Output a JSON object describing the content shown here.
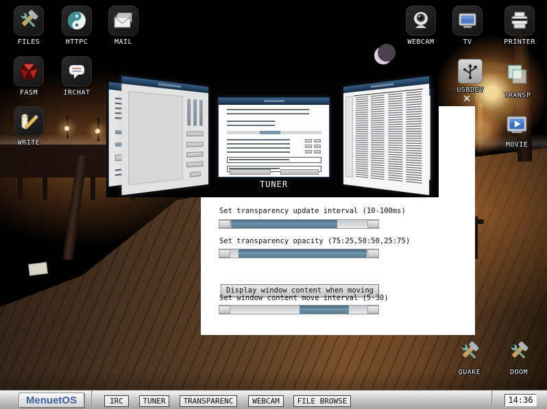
{
  "desktop": {
    "icons": [
      {
        "id": "files",
        "label": "FILES"
      },
      {
        "id": "httpc",
        "label": "HTTPC"
      },
      {
        "id": "mail",
        "label": "MAIL"
      },
      {
        "id": "webcam",
        "label": "WEBCAM"
      },
      {
        "id": "tv",
        "label": "TV"
      },
      {
        "id": "printer",
        "label": "PRINTER"
      },
      {
        "id": "fasm",
        "label": "FASM"
      },
      {
        "id": "irchat",
        "label": "IRCHAT"
      },
      {
        "id": "usbdev",
        "label": "USBDEV"
      },
      {
        "id": "transp",
        "label": "TRANSP"
      },
      {
        "id": "write",
        "label": "WRITE"
      },
      {
        "id": "movie",
        "label": "MOVIE"
      },
      {
        "id": "quake",
        "label": "QUAKE"
      },
      {
        "id": "doom",
        "label": "DOOM"
      }
    ]
  },
  "switcher": {
    "selected_label": "TUNER"
  },
  "transparency_window": {
    "close_icon": "✕",
    "update_interval_label": "Set transparency update interval (10-100ms)",
    "opacity_label": "Set transparency opacity (75:25,50:50,25:75)",
    "display_content_button": "Display window content when moving",
    "move_interval_label": "Set window content move interval (5-30)",
    "sliders": [
      {
        "name": "update_interval",
        "fill_left": "0%",
        "fill_width": "78.5%"
      },
      {
        "name": "opacity",
        "fill_left": "5.5%",
        "fill_width": "94.5%"
      },
      {
        "name": "move_interval",
        "fill_left": "50.5%",
        "fill_width": "36.5%"
      }
    ]
  },
  "taskbar": {
    "start_button": "MenuetOS",
    "tasks": [
      "IRC",
      "TUNER",
      "TRANSPARENC",
      "WEBCAM",
      "FILE BROWSE"
    ],
    "clock": "14:36"
  },
  "colors": {
    "slider_fill": "#5d84a0",
    "preview_titlebar": "#1e3c5a",
    "menuet_blue": "#3c5fa8",
    "overlay_background": "#000000"
  }
}
